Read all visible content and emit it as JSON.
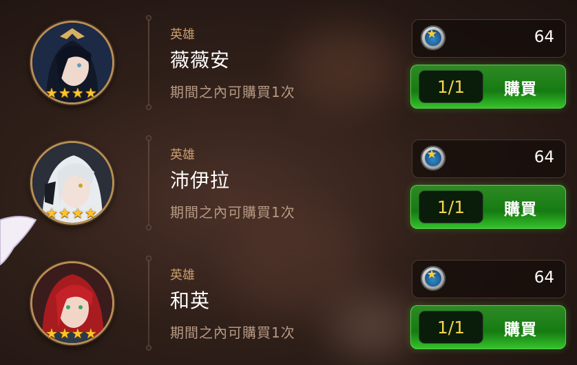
{
  "items": [
    {
      "category": "英雄",
      "name": "薇薇安",
      "limit_text": "期間之內可購買1次",
      "price": "64",
      "count": "1/1",
      "buy_label": "購買",
      "stars": [
        "★",
        "★",
        "★",
        "★"
      ]
    },
    {
      "category": "英雄",
      "name": "沛伊拉",
      "limit_text": "期間之內可購買1次",
      "price": "64",
      "count": "1/1",
      "buy_label": "購買",
      "stars": [
        "★",
        "★",
        "★",
        "★"
      ]
    },
    {
      "category": "英雄",
      "name": "和英",
      "limit_text": "期間之內可購買1次",
      "price": "64",
      "count": "1/1",
      "buy_label": "購買",
      "stars": [
        "★",
        "★",
        "★",
        "★"
      ]
    }
  ],
  "colors": {
    "buy_green": "#1f7f18",
    "star_gold": "#ffc42b",
    "count_text": "#f6d34d"
  },
  "icons": {
    "currency": "star-coin-icon",
    "star": "star-icon"
  }
}
